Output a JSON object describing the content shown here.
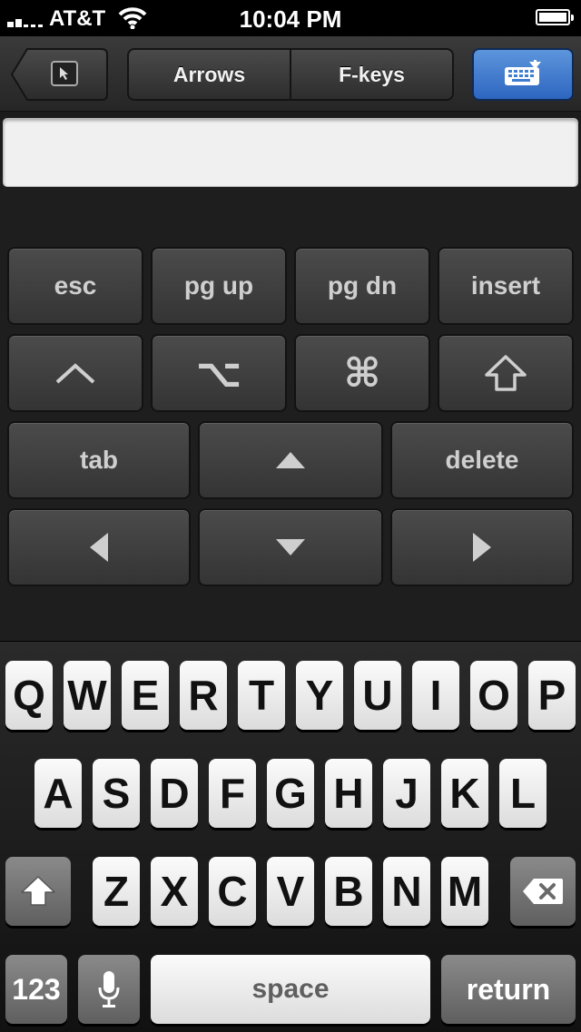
{
  "status": {
    "carrier": "AT&T",
    "time": "10:04 PM"
  },
  "toolbar": {
    "back_icon": "cursor-arrow-icon",
    "segments": [
      "Arrows",
      "F-keys"
    ],
    "keyboard_icon": "keyboard-hide-icon",
    "keyboard_color": "#3f7ed1"
  },
  "input": {
    "value": ""
  },
  "special_keys": {
    "esc": "esc",
    "pg_up": "pg up",
    "pg_dn": "pg dn",
    "insert": "insert",
    "ctrl": "^",
    "option": "⌥",
    "command": "⌘",
    "shift_icon": "shift-icon",
    "tab": "tab",
    "up_icon": "up-arrow-icon",
    "delete": "delete",
    "left_icon": "left-arrow-icon",
    "down_icon": "down-arrow-icon",
    "right_icon": "right-arrow-icon"
  },
  "keyboard": {
    "row1": [
      "Q",
      "W",
      "E",
      "R",
      "T",
      "Y",
      "U",
      "I",
      "O",
      "P"
    ],
    "row2": [
      "A",
      "S",
      "D",
      "F",
      "G",
      "H",
      "J",
      "K",
      "L"
    ],
    "row3": [
      "Z",
      "X",
      "C",
      "V",
      "B",
      "N",
      "M"
    ],
    "numbers": "123",
    "space": "space",
    "return": "return",
    "mic_icon": "microphone-icon",
    "shift_icon": "shift-icon",
    "backspace_icon": "backspace-icon"
  }
}
